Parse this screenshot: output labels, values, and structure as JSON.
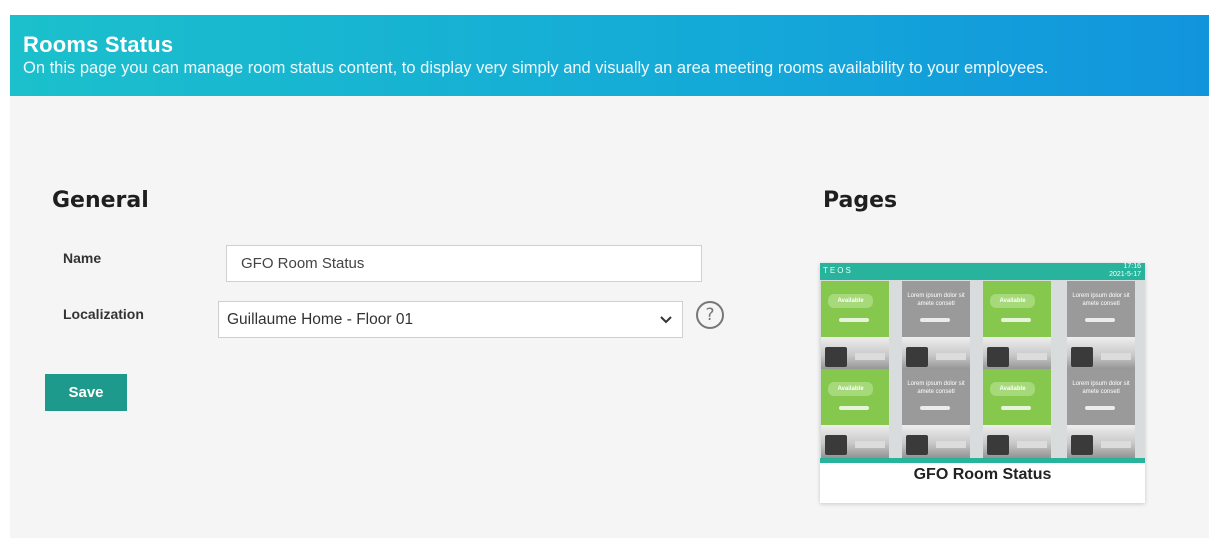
{
  "header": {
    "title": "Rooms Status",
    "subtitle": "On this page you can manage room status content, to display very simply and visually an area meeting rooms availability to your employees."
  },
  "general": {
    "title": "General",
    "name_label": "Name",
    "name_value": "GFO Room Status",
    "localization_label": "Localization",
    "localization_value": "Guillaume Home - Floor 01",
    "help_symbol": "?",
    "save_label": "Save"
  },
  "pages": {
    "title": "Pages",
    "card_title": "GFO Room Status",
    "thumbnail": {
      "brand": "TEOS",
      "time": "17:16",
      "date": "2021-5-17",
      "available_label": "Available",
      "busy_text": "Lorem ipsum dolor sit amete consetl"
    }
  },
  "colors": {
    "header_start": "#1bc0cc",
    "header_end": "#1294dd",
    "save_button": "#1e9a8c",
    "thumb_accent": "#27b39c"
  }
}
